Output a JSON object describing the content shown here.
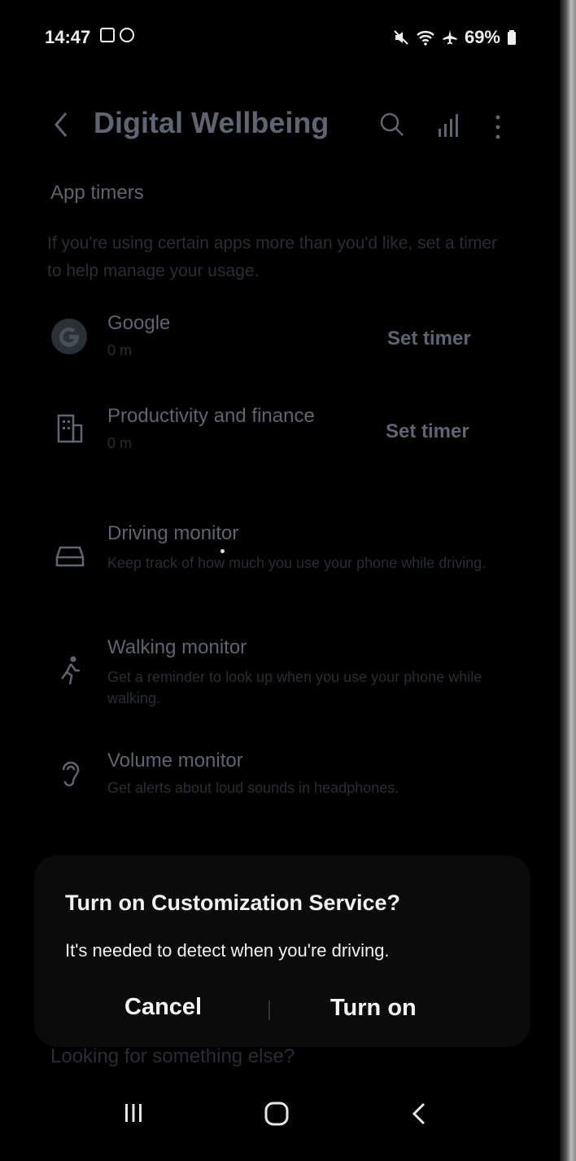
{
  "status_bar": {
    "time": "14:47",
    "battery": "69%"
  },
  "header": {
    "title": "Digital Wellbeing"
  },
  "app_timers": {
    "label": "App timers",
    "description": "If you're using certain apps more than you'd like, set a timer to help manage your usage.",
    "items": [
      {
        "name": "Google",
        "usage": "0 m",
        "action": "Set timer",
        "icon": "google-icon"
      },
      {
        "name": "Productivity and finance",
        "usage": "0 m",
        "action": "Set timer",
        "icon": "building-icon"
      }
    ]
  },
  "monitors": [
    {
      "name": "Driving monitor",
      "description": "Keep track of how much you use your phone while driving.",
      "icon": "car-icon"
    },
    {
      "name": "Walking monitor",
      "description": "Get a reminder to look up when you use your phone while walking.",
      "icon": "walking-icon"
    },
    {
      "name": "Volume monitor",
      "description": "Get alerts about loud sounds in headphones.",
      "icon": "ear-icon"
    }
  ],
  "dialog": {
    "title": "Turn on Customization Service?",
    "body": "It's needed to detect when you're driving.",
    "cancel_label": "Cancel",
    "confirm_label": "Turn on"
  },
  "behind_dialog_text": "Looking for something else?",
  "colors": {
    "background": "#000000",
    "dialog_background": "#0b0b0c",
    "dimmed_text": "#5e6470",
    "dialog_text": "#f1f1f1"
  }
}
